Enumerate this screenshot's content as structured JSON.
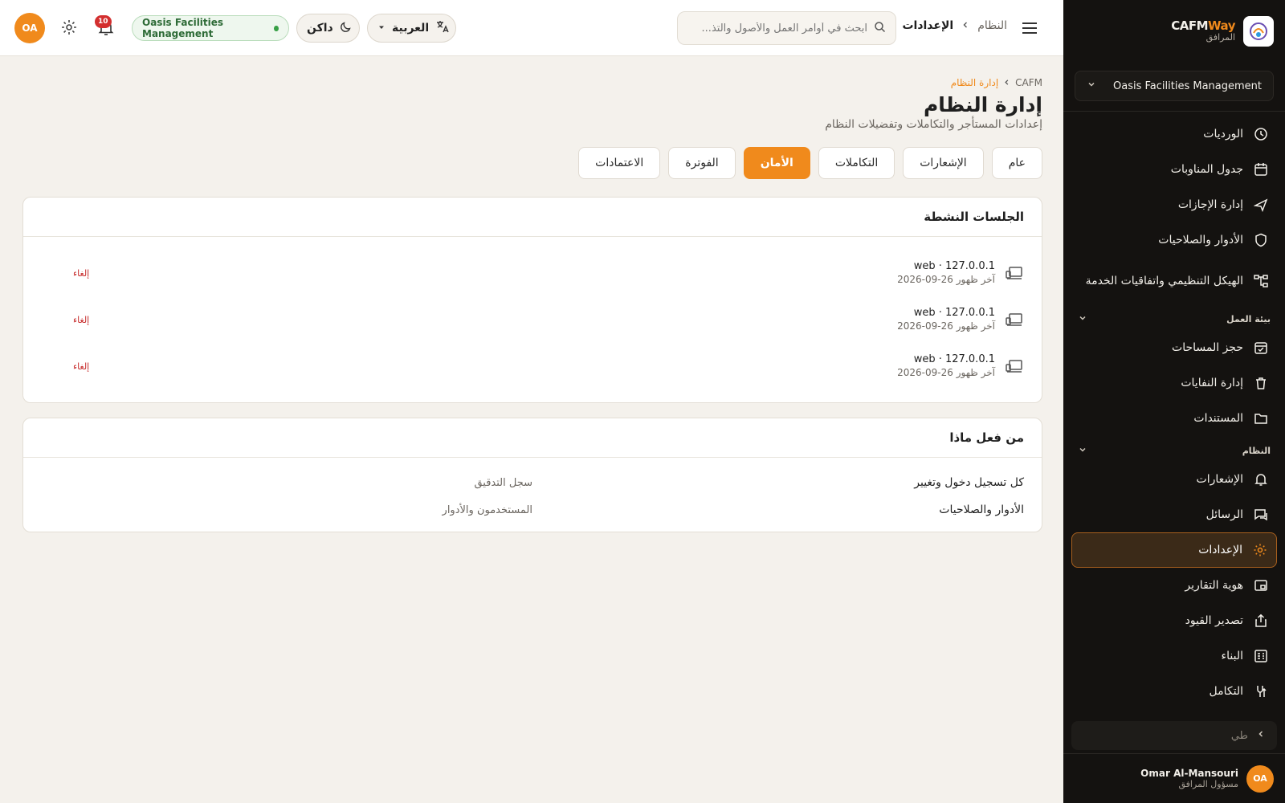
{
  "sidebar": {
    "brand_name_a": "CAFM",
    "brand_name_b": "Way",
    "brand_sub": "المرافق",
    "tenant": "Oasis Facilities Management",
    "items_top": [
      {
        "label": "الورديات",
        "icon": "clock-icon"
      },
      {
        "label": "جدول المناوبات",
        "icon": "calendar-icon"
      },
      {
        "label": "إدارة الإجازات",
        "icon": "plane-icon"
      },
      {
        "label": "الأدوار والصلاحيات",
        "icon": "shield-icon"
      },
      {
        "label": "الهيكل التنظيمي واتفاقيات الخدمة",
        "icon": "org-chart-icon"
      }
    ],
    "group_workplace": "بيئة العمل",
    "items_workplace": [
      {
        "label": "حجز المساحات",
        "icon": "calendar-check-icon"
      },
      {
        "label": "إدارة النفايات",
        "icon": "trash-icon"
      },
      {
        "label": "المستندات",
        "icon": "folder-icon"
      }
    ],
    "group_system": "النظام",
    "items_system": [
      {
        "label": "الإشعارات",
        "icon": "bell-icon"
      },
      {
        "label": "الرسائل",
        "icon": "chat-icon"
      },
      {
        "label": "الإعدادات",
        "icon": "gear-icon",
        "active": true
      },
      {
        "label": "هوية التقارير",
        "icon": "report-icon"
      },
      {
        "label": "تصدير القيود",
        "icon": "export-icon"
      },
      {
        "label": "البناء",
        "icon": "build-icon"
      },
      {
        "label": "التكامل",
        "icon": "integration-icon"
      }
    ],
    "collapse_label": "طي",
    "user_initials": "OA",
    "user_name": "Omar Al-Mansouri",
    "user_role": "مسؤول المرافق"
  },
  "topbar": {
    "crumb_parent": "النظام",
    "crumb_current": "الإعدادات",
    "search_placeholder": "ابحث في أوامر العمل والأصول والتذ...",
    "language": "العربية",
    "theme": "داكن",
    "org": "Oasis Facilities Management",
    "notifications_count": "10",
    "avatar_initials": "OA"
  },
  "page": {
    "breadcrumb_root": "CAFM",
    "breadcrumb_current": "إدارة النظام",
    "title": "إدارة النظام",
    "subtitle": "إعدادات المستأجر والتكاملات وتفضيلات النظام",
    "tabs": [
      {
        "label": "عام"
      },
      {
        "label": "الإشعارات"
      },
      {
        "label": "التكاملات"
      },
      {
        "label": "الأمان",
        "active": true
      },
      {
        "label": "الفوترة"
      },
      {
        "label": "الاعتمادات"
      }
    ]
  },
  "sessions": {
    "title": "الجلسات النشطة",
    "rows": [
      {
        "ip": "web · 127.0.0.1",
        "last_seen": "آخر ظهور 26-09-2026",
        "action": "إلغاء"
      },
      {
        "ip": "web · 127.0.0.1",
        "last_seen": "آخر ظهور 26-09-2026",
        "action": "إلغاء"
      },
      {
        "ip": "web · 127.0.0.1",
        "last_seen": "آخر ظهور 26-09-2026",
        "action": "إلغاء"
      }
    ]
  },
  "audit": {
    "title": "من فعل ماذا",
    "rows": [
      {
        "left": "كل تسجيل دخول وتغيير",
        "right": "سجل التدقيق"
      },
      {
        "left": "الأدوار والصلاحيات",
        "right": "المستخدمون والأدوار"
      }
    ]
  },
  "colors": {
    "accent": "#f08a1c",
    "sidebar_bg": "#141210",
    "page_bg": "#f4f1ec",
    "danger": "#c62828",
    "org_green": "#37a046"
  }
}
